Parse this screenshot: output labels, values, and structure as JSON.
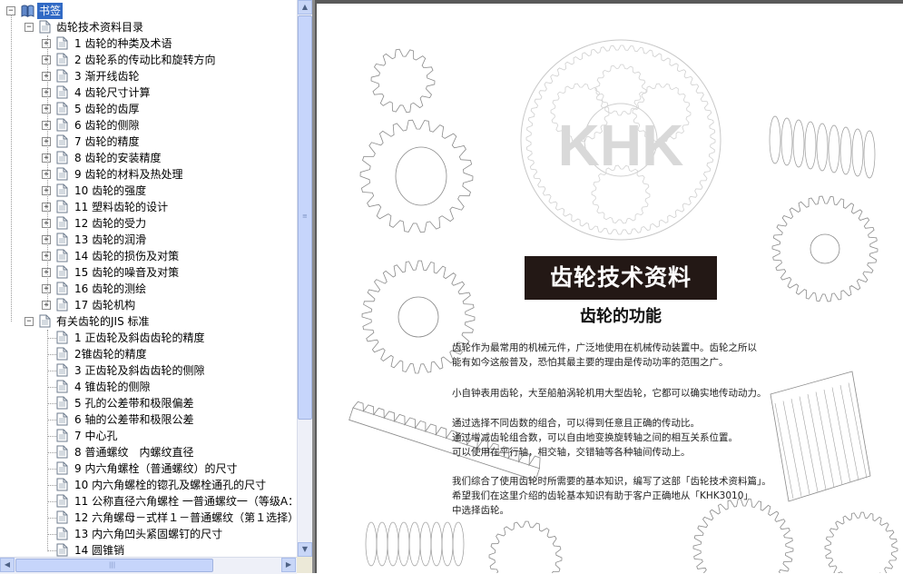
{
  "tree": {
    "root_label": "书签",
    "groups": [
      {
        "label": "齿轮技术资料目录",
        "items": [
          "1 齿轮的种类及术语",
          "2 齿轮系的传动比和旋转方向",
          "3 渐开线齿轮",
          "4 齿轮尺寸计算",
          "5 齿轮的齿厚",
          "6 齿轮的侧隙",
          "7 齿轮的精度",
          "8 齿轮的安装精度",
          "9 齿轮的材料及热处理",
          "10 齿轮的强度",
          "11 塑料齿轮的设计",
          "12 齿轮的受力",
          "13 齿轮的润滑",
          "14 齿轮的损伤及对策",
          "15 齿轮的噪音及对策",
          "16 齿轮的测绘",
          "17 齿轮机构"
        ]
      },
      {
        "label": "有关齿轮的JIS 标准",
        "items": [
          "1 正齿轮及斜齿齿轮的精度",
          "2锥齿轮的精度",
          "3 正齿轮及斜齿齿轮的侧隙",
          "4 锥齿轮的侧隙",
          "5 孔的公差带和极限偏差",
          "6 轴的公差带和极限公差",
          "7 中心孔",
          "8 普通螺纹　内螺纹直径",
          "9 内六角螺栓（普通螺纹）的尺寸",
          "10 内六角螺栓的锪孔及螺栓通孔的尺寸",
          "11 公称直径六角螺栓 一普通螺纹一（等级A：",
          "12 六角螺母－式样１－普通螺纹（第１选择）",
          "13 内六角凹头紧固螺钉的尺寸",
          "14 圆锥销"
        ]
      }
    ]
  },
  "document": {
    "watermark": "KHK",
    "title": "齿轮技术资料",
    "subtitle": "齿轮的功能",
    "paragraphs": [
      "齿轮作为最常用的机械元件，广泛地使用在机械传动装置中。齿轮之所以",
      "能有如今这般普及，恐怕其最主要的理由是传动功率的范围之广。",
      "小自钟表用齿轮，大至船舶涡轮机用大型齿轮，它都可以确实地传动动力。",
      "通过选择不同齿数的组合，可以得到任意且正确的传动比。",
      "通过增减齿轮组合数，可以自由地变换旋转轴之间的相互关系位置。",
      "可以使用在平行轴，相交轴，交错轴等各种轴间传动上。",
      "我们综合了使用齿轮时所需要的基本知识，编写了这部「齿轮技术资料篇」。",
      "希望我们在这里介绍的齿轮基本知识有助于客户正确地从「KHK3010」",
      "中选择齿轮。"
    ]
  },
  "icons": {
    "root": "book-icon",
    "item": "page-icon",
    "toggle_collapsed": "+",
    "toggle_expanded": "−"
  },
  "colors": {
    "selection": "#316ac5",
    "title_banner": "#231815",
    "scrollbar": "#c6d5fb"
  }
}
